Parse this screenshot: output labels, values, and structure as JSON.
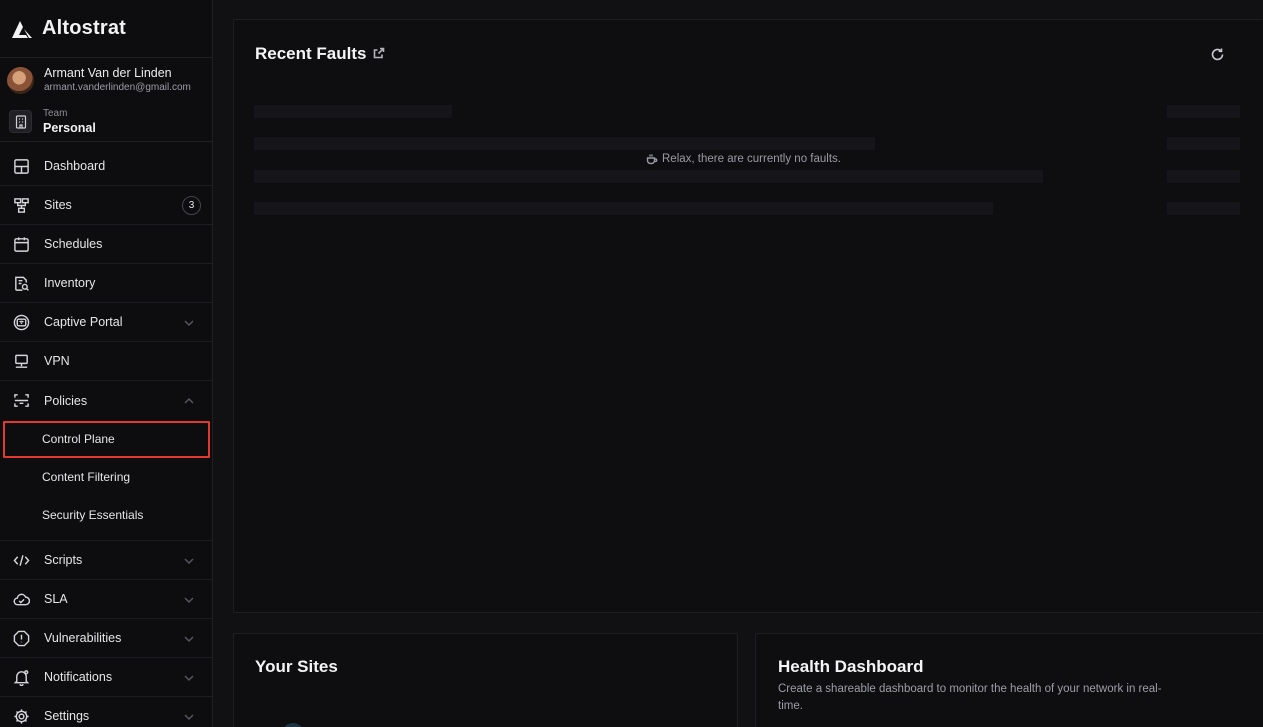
{
  "brand": {
    "name": "Altostrat"
  },
  "user": {
    "name": "Armant Van der Linden",
    "email": "armant.vanderlinden@gmail.com"
  },
  "team": {
    "label": "Team",
    "value": "Personal"
  },
  "nav": {
    "dashboard": "Dashboard",
    "sites": "Sites",
    "sites_count": "3",
    "schedules": "Schedules",
    "inventory": "Inventory",
    "captive_portal": "Captive Portal",
    "vpn": "VPN",
    "policies": "Policies",
    "policies_sub": [
      "Control Plane",
      "Content Filtering",
      "Security Essentials"
    ],
    "scripts": "Scripts",
    "sla": "SLA",
    "vulnerabilities": "Vulnerabilities",
    "notifications": "Notifications",
    "settings": "Settings"
  },
  "faults": {
    "title": "Recent Faults",
    "empty_message": "Relax, there are currently no faults."
  },
  "sites_card": {
    "title": "Your Sites"
  },
  "health_card": {
    "title": "Health Dashboard",
    "description": "Create a shareable dashboard to monitor the health of your network in real-time."
  }
}
